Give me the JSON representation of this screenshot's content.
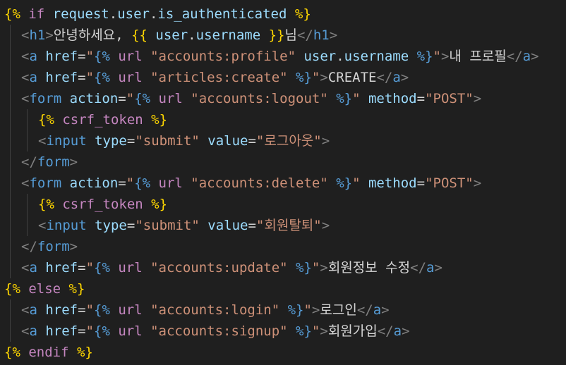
{
  "palette": {
    "background": "#1f1f1f",
    "bracket": "#ffd700",
    "keyword": "#c586c0",
    "variable": "#9cdcfe",
    "string": "#ce9178",
    "tag": "#569cd6",
    "angle": "#808080",
    "text": "#d4d4d4",
    "property": "#9cdcfe"
  },
  "lines": [
    {
      "indent": 0,
      "tokens": [
        [
          "{% ",
          "bracket"
        ],
        [
          "if ",
          "keyword"
        ],
        [
          "request",
          "variable"
        ],
        [
          ".",
          "text"
        ],
        [
          "user",
          "variable"
        ],
        [
          ".",
          "text"
        ],
        [
          "is_authenticated",
          "variable"
        ],
        [
          " %}",
          "bracket"
        ]
      ]
    },
    {
      "indent": 1,
      "tokens": [
        [
          "<",
          "angle"
        ],
        [
          "h1",
          "tag"
        ],
        [
          ">",
          "angle"
        ],
        [
          "안녕하세요, ",
          "text"
        ],
        [
          "{{ ",
          "bracket"
        ],
        [
          "user",
          "variable"
        ],
        [
          ".",
          "text"
        ],
        [
          "username",
          "variable"
        ],
        [
          " }}",
          "bracket"
        ],
        [
          "님",
          "text"
        ],
        [
          "</",
          "angle"
        ],
        [
          "h1",
          "tag"
        ],
        [
          ">",
          "angle"
        ]
      ]
    },
    {
      "indent": 1,
      "tokens": [
        [
          "<",
          "angle"
        ],
        [
          "a ",
          "tag"
        ],
        [
          "href",
          "property"
        ],
        [
          "=",
          "text"
        ],
        [
          "\"",
          "string"
        ],
        [
          "{% ",
          "tag"
        ],
        [
          "url ",
          "keyword"
        ],
        [
          "\"accounts:profile\" ",
          "string"
        ],
        [
          "user",
          "variable"
        ],
        [
          ".",
          "text"
        ],
        [
          "username",
          "variable"
        ],
        [
          " %}",
          "tag"
        ],
        [
          "\"",
          "string"
        ],
        [
          ">",
          "angle"
        ],
        [
          "내 프로필",
          "text"
        ],
        [
          "</",
          "angle"
        ],
        [
          "a",
          "tag"
        ],
        [
          ">",
          "angle"
        ]
      ]
    },
    {
      "indent": 1,
      "tokens": [
        [
          "<",
          "angle"
        ],
        [
          "a ",
          "tag"
        ],
        [
          "href",
          "property"
        ],
        [
          "=",
          "text"
        ],
        [
          "\"",
          "string"
        ],
        [
          "{% ",
          "tag"
        ],
        [
          "url ",
          "keyword"
        ],
        [
          "\"articles:create\" ",
          "string"
        ],
        [
          "%}",
          "tag"
        ],
        [
          "\"",
          "string"
        ],
        [
          ">",
          "angle"
        ],
        [
          "CREATE",
          "text"
        ],
        [
          "</",
          "angle"
        ],
        [
          "a",
          "tag"
        ],
        [
          ">",
          "angle"
        ]
      ]
    },
    {
      "indent": 1,
      "tokens": [
        [
          "<",
          "angle"
        ],
        [
          "form ",
          "tag"
        ],
        [
          "action",
          "property"
        ],
        [
          "=",
          "text"
        ],
        [
          "\"",
          "string"
        ],
        [
          "{% ",
          "tag"
        ],
        [
          "url ",
          "keyword"
        ],
        [
          "\"accounts:logout\" ",
          "string"
        ],
        [
          "%}",
          "tag"
        ],
        [
          "\" ",
          "string"
        ],
        [
          "method",
          "property"
        ],
        [
          "=",
          "text"
        ],
        [
          "\"POST\"",
          "string"
        ],
        [
          ">",
          "angle"
        ]
      ]
    },
    {
      "indent": 2,
      "tokens": [
        [
          "{% ",
          "bracket"
        ],
        [
          "csrf_token",
          "keyword"
        ],
        [
          " %}",
          "bracket"
        ]
      ]
    },
    {
      "indent": 2,
      "tokens": [
        [
          "<",
          "angle"
        ],
        [
          "input ",
          "tag"
        ],
        [
          "type",
          "property"
        ],
        [
          "=",
          "text"
        ],
        [
          "\"submit\" ",
          "string"
        ],
        [
          "value",
          "property"
        ],
        [
          "=",
          "text"
        ],
        [
          "\"로그아웃\"",
          "string"
        ],
        [
          ">",
          "angle"
        ]
      ]
    },
    {
      "indent": 1,
      "tokens": [
        [
          "</",
          "angle"
        ],
        [
          "form",
          "tag"
        ],
        [
          ">",
          "angle"
        ]
      ]
    },
    {
      "indent": 1,
      "tokens": [
        [
          "<",
          "angle"
        ],
        [
          "form ",
          "tag"
        ],
        [
          "action",
          "property"
        ],
        [
          "=",
          "text"
        ],
        [
          "\"",
          "string"
        ],
        [
          "{% ",
          "tag"
        ],
        [
          "url ",
          "keyword"
        ],
        [
          "\"accounts:delete\" ",
          "string"
        ],
        [
          "%}",
          "tag"
        ],
        [
          "\" ",
          "string"
        ],
        [
          "method",
          "property"
        ],
        [
          "=",
          "text"
        ],
        [
          "\"POST\"",
          "string"
        ],
        [
          ">",
          "angle"
        ]
      ]
    },
    {
      "indent": 2,
      "tokens": [
        [
          "{% ",
          "bracket"
        ],
        [
          "csrf_token",
          "keyword"
        ],
        [
          " %}",
          "bracket"
        ]
      ]
    },
    {
      "indent": 2,
      "tokens": [
        [
          "<",
          "angle"
        ],
        [
          "input ",
          "tag"
        ],
        [
          "type",
          "property"
        ],
        [
          "=",
          "text"
        ],
        [
          "\"submit\" ",
          "string"
        ],
        [
          "value",
          "property"
        ],
        [
          "=",
          "text"
        ],
        [
          "\"회원탈퇴\"",
          "string"
        ],
        [
          ">",
          "angle"
        ]
      ]
    },
    {
      "indent": 1,
      "tokens": [
        [
          "</",
          "angle"
        ],
        [
          "form",
          "tag"
        ],
        [
          ">",
          "angle"
        ]
      ]
    },
    {
      "indent": 1,
      "tokens": [
        [
          "<",
          "angle"
        ],
        [
          "a ",
          "tag"
        ],
        [
          "href",
          "property"
        ],
        [
          "=",
          "text"
        ],
        [
          "\"",
          "string"
        ],
        [
          "{% ",
          "tag"
        ],
        [
          "url ",
          "keyword"
        ],
        [
          "\"accounts:update\" ",
          "string"
        ],
        [
          "%}",
          "tag"
        ],
        [
          "\"",
          "string"
        ],
        [
          ">",
          "angle"
        ],
        [
          "회원정보 수정",
          "text"
        ],
        [
          "</",
          "angle"
        ],
        [
          "a",
          "tag"
        ],
        [
          ">",
          "angle"
        ]
      ]
    },
    {
      "indent": 0,
      "tokens": [
        [
          "{% ",
          "bracket"
        ],
        [
          "else",
          "keyword"
        ],
        [
          " %}",
          "bracket"
        ]
      ]
    },
    {
      "indent": 1,
      "tokens": [
        [
          "<",
          "angle"
        ],
        [
          "a ",
          "tag"
        ],
        [
          "href",
          "property"
        ],
        [
          "=",
          "text"
        ],
        [
          "\"",
          "string"
        ],
        [
          "{% ",
          "tag"
        ],
        [
          "url ",
          "keyword"
        ],
        [
          "\"accounts:login\" ",
          "string"
        ],
        [
          "%}",
          "tag"
        ],
        [
          "\"",
          "string"
        ],
        [
          ">",
          "angle"
        ],
        [
          "로그인",
          "text"
        ],
        [
          "</",
          "angle"
        ],
        [
          "a",
          "tag"
        ],
        [
          ">",
          "angle"
        ]
      ]
    },
    {
      "indent": 1,
      "tokens": [
        [
          "<",
          "angle"
        ],
        [
          "a ",
          "tag"
        ],
        [
          "href",
          "property"
        ],
        [
          "=",
          "text"
        ],
        [
          "\"",
          "string"
        ],
        [
          "{% ",
          "tag"
        ],
        [
          "url ",
          "keyword"
        ],
        [
          "\"accounts:signup\" ",
          "string"
        ],
        [
          "%}",
          "tag"
        ],
        [
          "\"",
          "string"
        ],
        [
          ">",
          "angle"
        ],
        [
          "회원가입",
          "text"
        ],
        [
          "</",
          "angle"
        ],
        [
          "a",
          "tag"
        ],
        [
          ">",
          "angle"
        ]
      ]
    },
    {
      "indent": 0,
      "tokens": [
        [
          "{% ",
          "bracket"
        ],
        [
          "endif",
          "keyword"
        ],
        [
          " %}",
          "bracket"
        ]
      ]
    }
  ]
}
